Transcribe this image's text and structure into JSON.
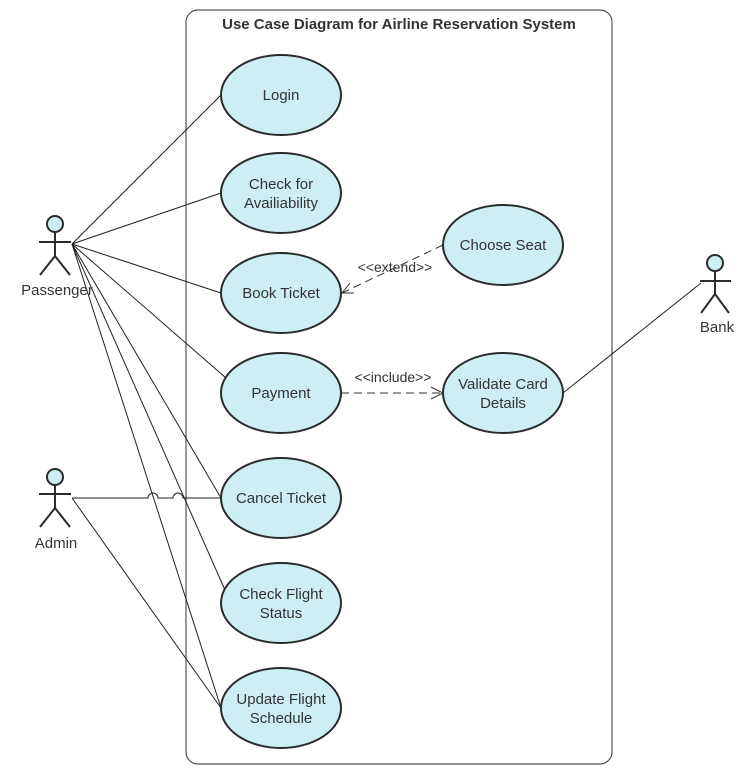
{
  "diagram": {
    "title": "Use Case Diagram for Airline Reservation System",
    "colors": {
      "use_case_fill": "#cdeff4",
      "outline": "#2b2b2b",
      "text": "#333333"
    },
    "actors": [
      {
        "id": "passenger",
        "label": "Passenger"
      },
      {
        "id": "admin",
        "label": "Admin"
      },
      {
        "id": "bank",
        "label": "Bank"
      }
    ],
    "use_cases": [
      {
        "id": "login",
        "lines": [
          "Login"
        ]
      },
      {
        "id": "check-availability",
        "lines": [
          "Check for",
          "Availiability"
        ]
      },
      {
        "id": "book-ticket",
        "lines": [
          "Book Ticket"
        ]
      },
      {
        "id": "payment",
        "lines": [
          "Payment"
        ]
      },
      {
        "id": "cancel-ticket",
        "lines": [
          "Cancel Ticket"
        ]
      },
      {
        "id": "check-flight-status",
        "lines": [
          "Check Flight",
          "Status"
        ]
      },
      {
        "id": "update-flight-schedule",
        "lines": [
          "Update Flight",
          "Schedule"
        ]
      },
      {
        "id": "choose-seat",
        "lines": [
          "Choose Seat"
        ]
      },
      {
        "id": "validate-card",
        "lines": [
          "Validate Card",
          "Details"
        ]
      }
    ],
    "associations": [
      {
        "from": "passenger",
        "to": "login"
      },
      {
        "from": "passenger",
        "to": "check-availability"
      },
      {
        "from": "passenger",
        "to": "book-ticket"
      },
      {
        "from": "passenger",
        "to": "payment"
      },
      {
        "from": "passenger",
        "to": "cancel-ticket"
      },
      {
        "from": "passenger",
        "to": "check-flight-status"
      },
      {
        "from": "passenger",
        "to": "update-flight-schedule"
      },
      {
        "from": "admin",
        "to": "cancel-ticket"
      },
      {
        "from": "admin",
        "to": "update-flight-schedule"
      },
      {
        "from": "bank",
        "to": "validate-card"
      }
    ],
    "relationships": [
      {
        "type": "extend",
        "label": "<<extend>>",
        "from": "choose-seat",
        "to": "book-ticket"
      },
      {
        "type": "include",
        "label": "<<include>>",
        "from": "payment",
        "to": "validate-card"
      }
    ]
  }
}
